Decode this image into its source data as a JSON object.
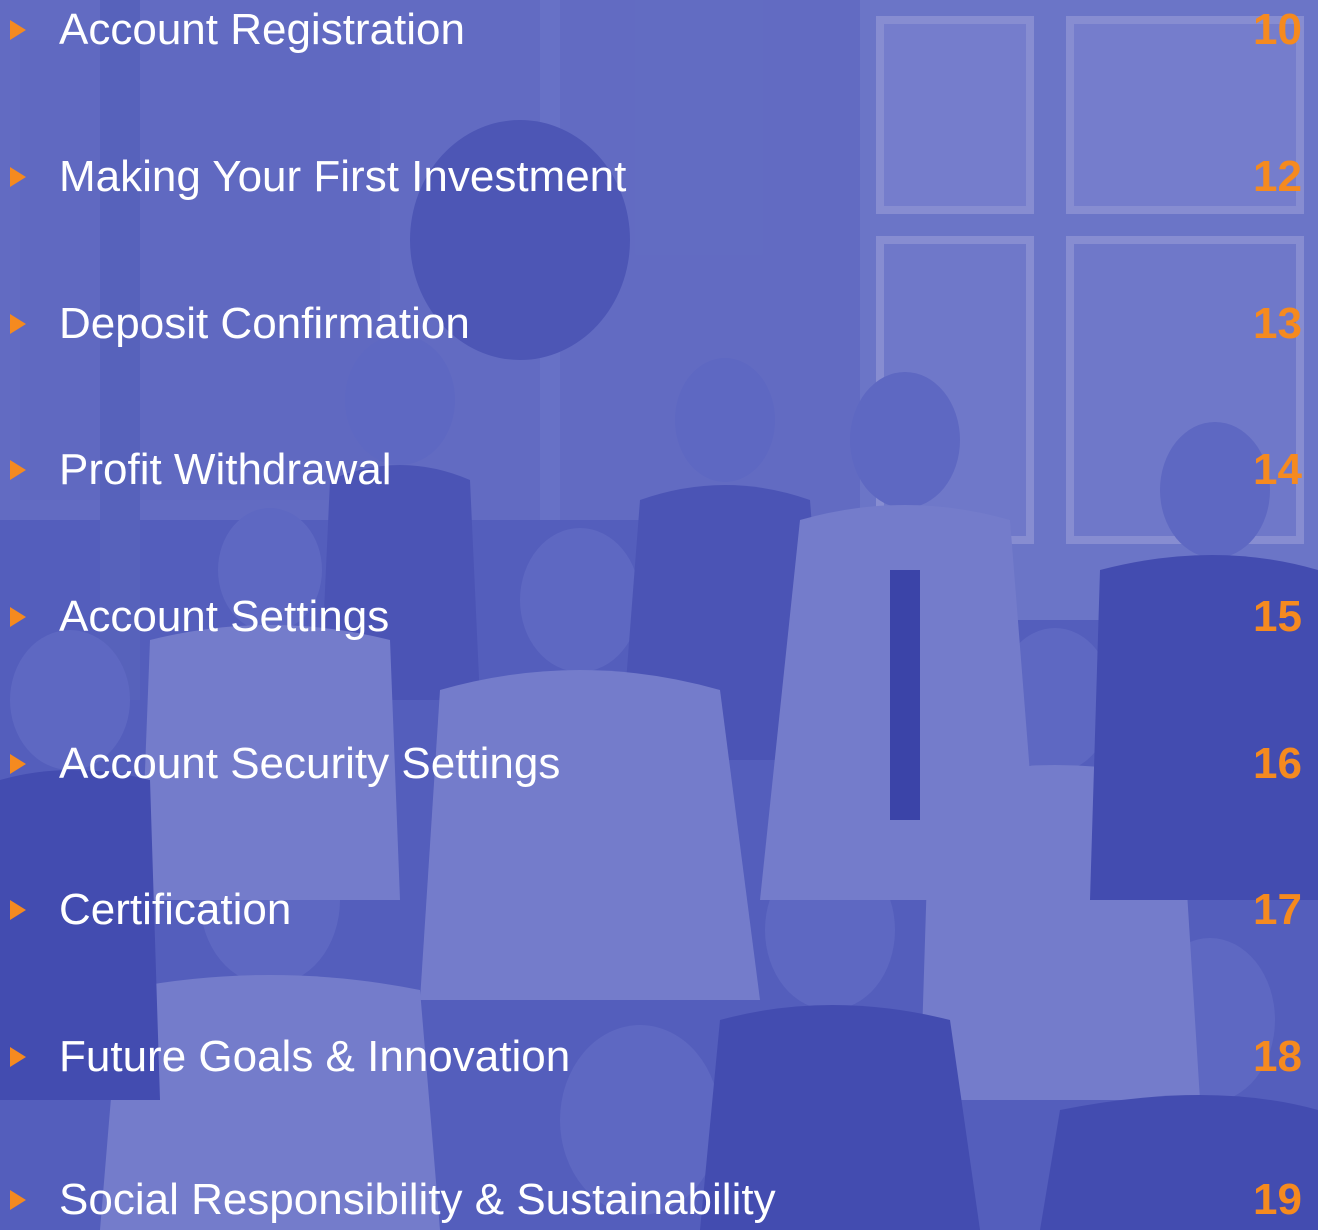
{
  "toc": {
    "items": [
      {
        "label": "Account Registration",
        "page": "10"
      },
      {
        "label": "Making Your First Investment",
        "page": "12"
      },
      {
        "label": "Deposit Confirmation",
        "page": "13"
      },
      {
        "label": "Profit Withdrawal",
        "page": "14"
      },
      {
        "label": "Account Settings",
        "page": "15"
      },
      {
        "label": "Account Security Settings",
        "page": "16"
      },
      {
        "label": "Certification",
        "page": "17"
      },
      {
        "label": "Future Goals & Innovation",
        "page": "18"
      },
      {
        "label": "Social Responsibility & Sustainability",
        "page": "19"
      }
    ]
  },
  "colors": {
    "overlay": "#3e46b2",
    "accent": "#f58a1f",
    "text": "#ffffff"
  },
  "icons": {
    "bullet": "chevron-right-icon"
  }
}
